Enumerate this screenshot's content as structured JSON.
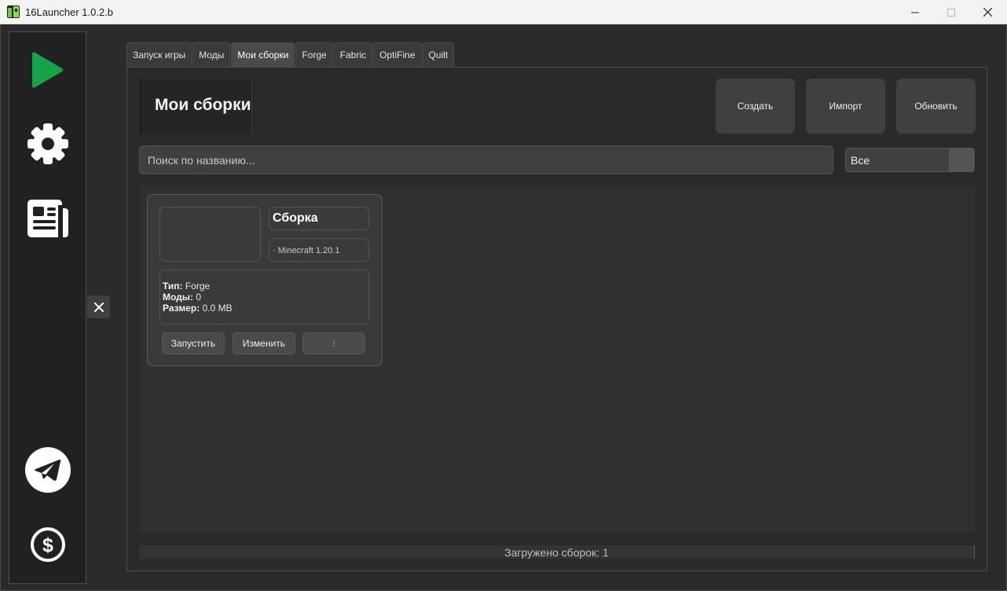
{
  "window": {
    "title": "16Launcher 1.0.2.b"
  },
  "sidebar": {
    "items": [
      {
        "name": "play",
        "icon": "play-icon"
      },
      {
        "name": "settings",
        "icon": "gear-icon"
      },
      {
        "name": "news",
        "icon": "news-icon"
      },
      {
        "name": "telegram",
        "icon": "telegram-icon"
      },
      {
        "name": "donate",
        "icon": "dollar-icon"
      }
    ],
    "accent": "#16a34a"
  },
  "tabs": [
    {
      "label": "Запуск игры",
      "active": false
    },
    {
      "label": "Моды",
      "active": false
    },
    {
      "label": "Мои сборки",
      "active": true
    },
    {
      "label": "Forge",
      "active": false
    },
    {
      "label": "Fabric",
      "active": false
    },
    {
      "label": "OptiFine",
      "active": false
    },
    {
      "label": "Quilt",
      "active": false
    }
  ],
  "page": {
    "title": "Мои сборки",
    "actions": {
      "create": "Создать",
      "import": "Импорт",
      "refresh": "Обновить"
    },
    "search_placeholder": "Поиск по названию...",
    "filter_value": "Все"
  },
  "builds": [
    {
      "name": "Сборка",
      "version": "· Minecraft 1.20.1",
      "type_label": "Тип:",
      "type_value": "Forge",
      "mods_label": "Моды:",
      "mods_value": "0",
      "size_label": "Размер:",
      "size_value": "0.0 MB",
      "launch": "Запустить",
      "edit": "Изменить",
      "more": "⋮"
    }
  ],
  "status": "Загружено сборок: 1"
}
